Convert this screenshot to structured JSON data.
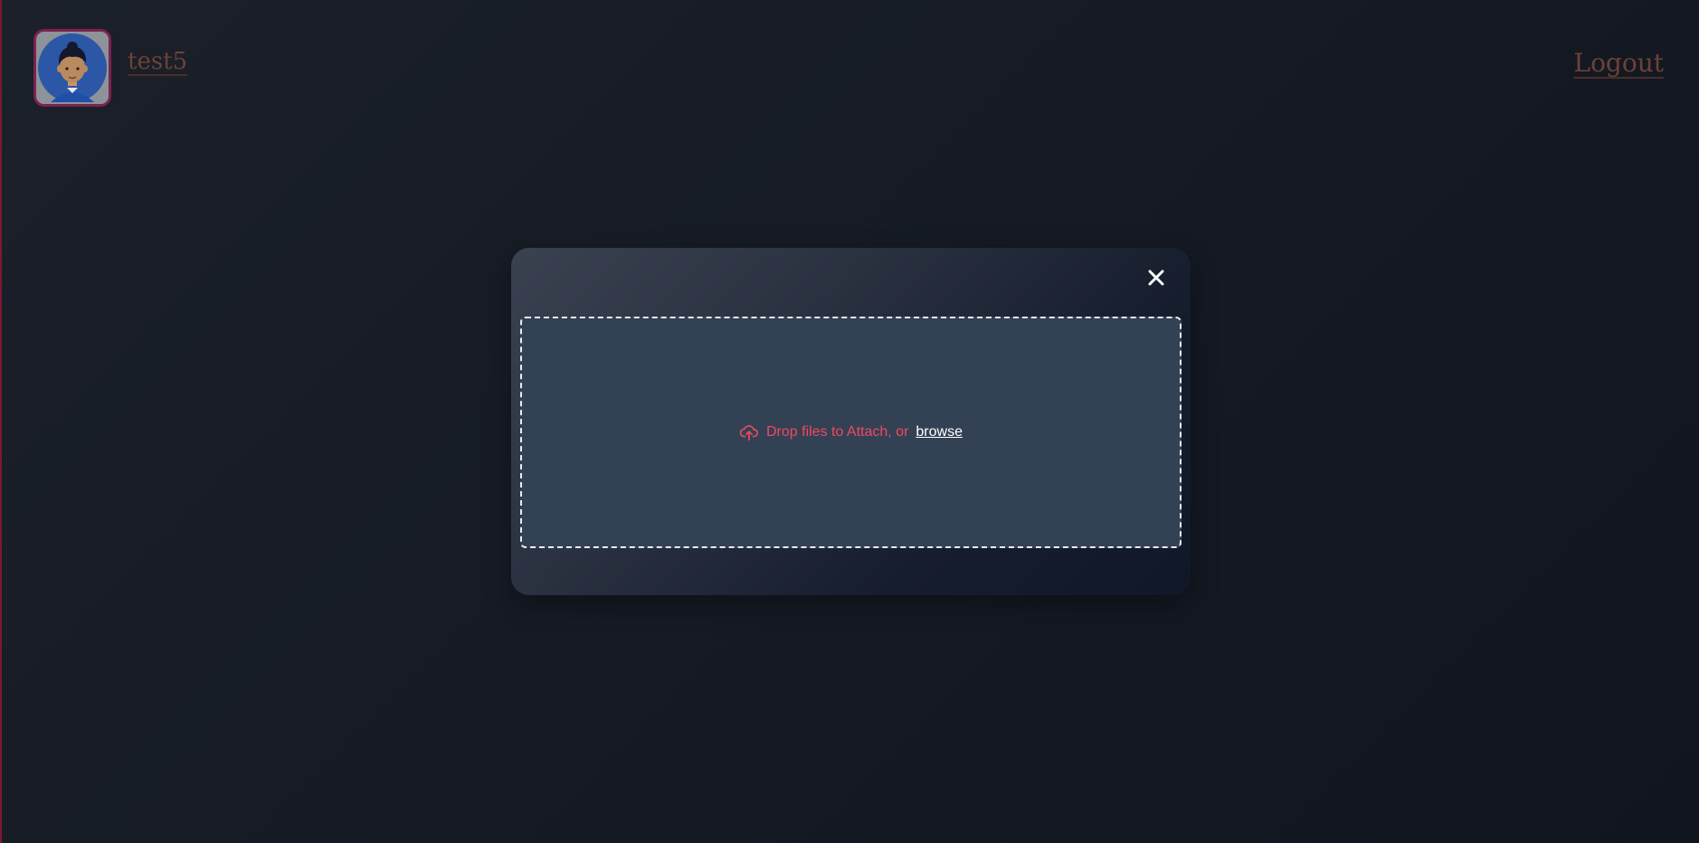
{
  "header": {
    "username": "test5",
    "logout_label": "Logout"
  },
  "modal": {
    "close_symbol": "✕",
    "dropzone": {
      "upload_icon": "cloud-upload-icon",
      "prompt_text": "Drop files to Attach, or",
      "browse_label": "browse"
    }
  },
  "colors": {
    "accent": "#f04a5e",
    "dropzone_bg": "#334155",
    "dropzone_border": "#e9edf2",
    "header_link": "#6b4238",
    "avatar_border": "#7a2350"
  }
}
